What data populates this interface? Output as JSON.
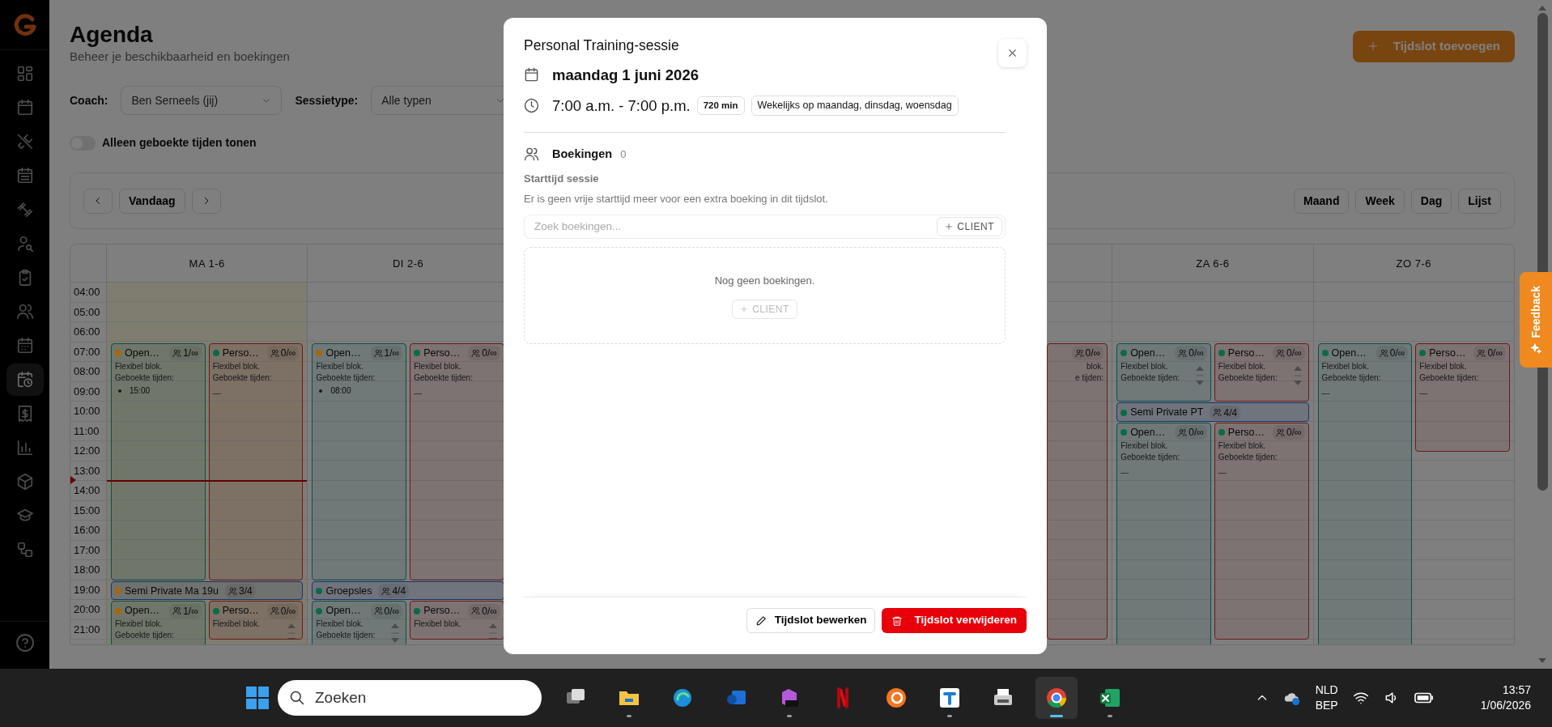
{
  "sidebar": {
    "items": [
      {
        "selected": false
      },
      {
        "selected": false
      },
      {
        "selected": false
      },
      {
        "selected": false
      },
      {
        "selected": false
      },
      {
        "selected": false
      },
      {
        "selected": false
      },
      {
        "selected": false
      },
      {
        "selected": false
      },
      {
        "selected": true
      },
      {
        "selected": false
      },
      {
        "selected": false
      },
      {
        "selected": false
      },
      {
        "selected": false
      },
      {
        "selected": false
      }
    ]
  },
  "header": {
    "title": "Agenda",
    "subtitle": "Beheer je beschikbaarheid en boekingen",
    "add_button": "Tijdslot toevoegen"
  },
  "filters": {
    "coach_label": "Coach:",
    "coach_value": "Ben Serneels (jij)",
    "type_label": "Sessietype:",
    "type_value": "Alle typen",
    "toggle_label": "Alleen geboekte tijden tonen",
    "toggle_on": false
  },
  "toolbar": {
    "today_button": "Vandaag",
    "views": [
      "Maand",
      "Week",
      "Dag",
      "Lijst"
    ]
  },
  "calendar": {
    "hours": [
      "04:00",
      "05:00",
      "06:00",
      "07:00",
      "08:00",
      "09:00",
      "10:00",
      "11:00",
      "12:00",
      "13:00",
      "14:00",
      "15:00",
      "16:00",
      "17:00",
      "18:00",
      "19:00",
      "20:00",
      "21:00"
    ],
    "days": [
      {
        "label": "MA 1-6",
        "today": true,
        "events": [
          {
            "kind": "open",
            "color": "#a8670c",
            "title": "Open…",
            "count": "1/∞",
            "lines": [
              "Flexibel blok.",
              "Geboekte tijden:"
            ],
            "booked": [
              "15:00"
            ]
          },
          {
            "kind": "personal",
            "color": "#0b6b48",
            "title": "Perso…",
            "count": "0/∞",
            "lines": [
              "Flexibel blok.",
              "Geboekte tijden:"
            ],
            "none_text": "—"
          },
          {
            "kind": "class",
            "color": "#a8670c",
            "title": "Semi Private Ma 19u",
            "count": "3/4"
          },
          {
            "kind": "open",
            "color": "#a8670c",
            "title": "Open…",
            "count": "1/∞",
            "lines": [
              "Flexibel blok.",
              "Geboekte tijden:"
            ]
          },
          {
            "kind": "personal",
            "color": "#0b6b48",
            "title": "Perso…",
            "count": "0/∞",
            "lines": [
              "Flexibel blok."
            ],
            "scroll": true
          }
        ]
      },
      {
        "label": "DI 2-6",
        "today": false,
        "events": [
          {
            "kind": "open",
            "color": "#a8670c",
            "title": "Open…",
            "count": "1/∞",
            "lines": [
              "Flexibel blok.",
              "Geboekte tijden:"
            ],
            "booked": [
              "08:00"
            ]
          },
          {
            "kind": "personal",
            "color": "#0b6b48",
            "title": "Perso…",
            "count": "0/∞",
            "lines": [
              "Flexibel blok.",
              "Geboekte tijden:"
            ],
            "none_text": "—"
          },
          {
            "kind": "class",
            "color": "#0b6b48",
            "title": "Groepsles",
            "count": "4/4"
          },
          {
            "kind": "open",
            "color": "#0b6b48",
            "title": "Open…",
            "count": "0/∞",
            "lines": [
              "Flexibel blok.",
              "Geboekte tijden:"
            ],
            "scroll": true
          },
          {
            "kind": "personal",
            "color": "#0b6b48",
            "title": "Perso…",
            "count": "0/∞",
            "lines": [
              "Flexibel blok."
            ],
            "scroll": true
          }
        ]
      },
      {
        "today": false,
        "events": [
          {
            "kind": "personal",
            "count": "0/∞",
            "lines": [
              "blok.",
              "e tijden:"
            ]
          }
        ]
      },
      {
        "label": "ZA 6-6",
        "today": false,
        "events": [
          {
            "kind": "open",
            "color": "#0b6b48",
            "title": "Open…",
            "count": "0/∞",
            "lines": [
              "Flexibel blok.",
              "Geboekte tijden:"
            ],
            "scroll": true
          },
          {
            "kind": "personal",
            "color": "#0b6b48",
            "title": "Perso…",
            "count": "0/∞",
            "lines": [
              "Flexibel blok.",
              "Geboekte tijden:"
            ],
            "scroll": true
          },
          {
            "kind": "class",
            "color": "#0b6b48",
            "title": "Semi Private PT",
            "count": "4/4"
          },
          {
            "kind": "open",
            "color": "#0b6b48",
            "title": "Open…",
            "count": "0/∞",
            "lines": [
              "Flexibel blok.",
              "Geboekte tijden:"
            ],
            "none_text": "—"
          },
          {
            "kind": "personal",
            "color": "#0b6b48",
            "title": "Perso…",
            "count": "0/∞",
            "lines": [
              "Flexibel blok.",
              "Geboekte tijden:"
            ],
            "none_text": "—"
          }
        ]
      },
      {
        "label": "ZO 7-6",
        "today": false,
        "events": [
          {
            "kind": "open",
            "color": "#0b6b48",
            "title": "Open…",
            "count": "0/∞",
            "lines": [
              "Flexibel blok.",
              "Geboekte tijden:"
            ],
            "none_text": "—"
          },
          {
            "kind": "personal",
            "color": "#0b6b48",
            "title": "Perso…",
            "count": "0/∞",
            "lines": [
              "Flexibel blok.",
              "Geboekte tijden:"
            ],
            "none_text": "—"
          }
        ]
      }
    ]
  },
  "modal": {
    "title": "Personal Training-sessie",
    "date": "maandag 1 juni 2026",
    "time": "7:00 a.m. - 7:00 p.m.",
    "duration": "720 min",
    "recurrence": "Wekelijks op maandag, dinsdag, woensdag",
    "bookings_title": "Boekingen",
    "bookings_count": "0",
    "start_label": "Starttijd sessie",
    "start_message": "Er is geen vrije starttijd meer voor een extra boeking in dit tijdslot.",
    "search_placeholder": "Zoek boekingen...",
    "add_client": "CLIENT",
    "empty_text": "Nog geen boekingen.",
    "empty_add_client": "CLIENT",
    "empty_add_disabled": true,
    "edit_button": "Tijdslot bewerken",
    "delete_button": "Tijdslot verwijderen"
  },
  "feedback": "Feedback",
  "taskbar": {
    "search": "Zoeken",
    "apps": [
      {
        "selected": false,
        "running": false
      },
      {
        "selected": false,
        "running": true
      },
      {
        "selected": false,
        "running": false
      },
      {
        "selected": false,
        "running": false
      },
      {
        "selected": false,
        "running": true
      },
      {
        "selected": false,
        "running": false
      },
      {
        "selected": false,
        "running": false
      },
      {
        "selected": false,
        "running": true
      },
      {
        "selected": false,
        "running": false
      },
      {
        "selected": true,
        "running": true
      },
      {
        "selected": false,
        "running": true
      }
    ],
    "language": "NLD",
    "layout": "BEP",
    "time": "13:57",
    "date": "1/06/2026"
  }
}
